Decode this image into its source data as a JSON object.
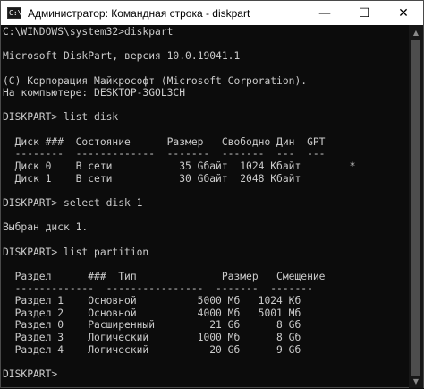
{
  "window": {
    "title": "Администратор: Командная строка - diskpart",
    "icon_text": "C:\\",
    "minimize": "—",
    "maximize": "☐",
    "close": "✕"
  },
  "console": {
    "lines": [
      "C:\\WINDOWS\\system32>diskpart",
      "",
      "Microsoft DiskPart, версия 10.0.19041.1",
      "",
      "(C) Корпорация Майкрософт (Microsoft Corporation).",
      "На компьютере: DESKTOP-3GOL3CH",
      "",
      "DISKPART> list disk",
      "",
      "  Диск ###  Состояние      Размер   Свободно Дин  GPT",
      "  --------  -------------  -------  -------  ---  ---",
      "  Диск 0    В сети           35 Gбайт  1024 Кбайт        *",
      "  Диск 1    В сети           30 Gбайт  2048 Кбайт",
      "",
      "DISKPART> select disk 1",
      "",
      "Выбран диск 1.",
      "",
      "DISKPART> list partition",
      "",
      "  Раздел      ###  Тип              Размер   Смещение",
      "  -------------  ----------------  -------  -------",
      "  Раздел 1    Основной          5000 Мб   1024 Кб",
      "  Раздел 2    Основной          4000 Мб   5001 Мб",
      "  Раздел 0    Расширенный         21 Gб      8 Gб",
      "  Раздел 3    Логический        1000 Мб      8 Gб",
      "  Раздел 4    Логический          20 Gб      9 Gб",
      "",
      "DISKPART>"
    ]
  },
  "scrollbar": {
    "up": "▲",
    "down": "▼"
  }
}
